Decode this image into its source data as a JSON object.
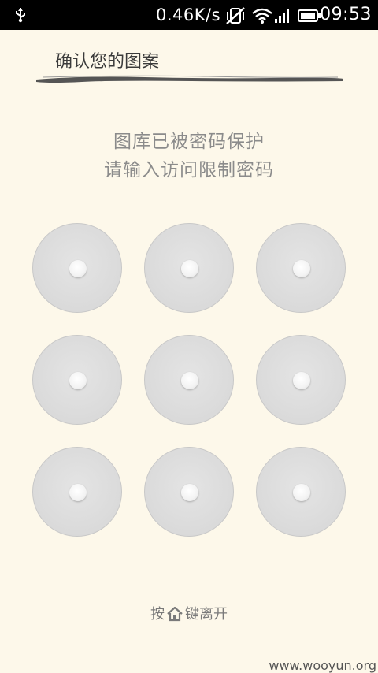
{
  "status_bar": {
    "net_speed": "0.46K/s",
    "clock": "09:53",
    "icons": [
      "usb-icon",
      "vibrate-silent-icon",
      "wifi-icon",
      "signal-icon",
      "battery-icon"
    ]
  },
  "screen": {
    "title": "确认您的图案",
    "prompt_line1": "图库已被密码保护",
    "prompt_line2": "请输入访问限制密码",
    "pattern_dots": [
      {
        "id": 1
      },
      {
        "id": 2
      },
      {
        "id": 3
      },
      {
        "id": 4
      },
      {
        "id": 5
      },
      {
        "id": 6
      },
      {
        "id": 7
      },
      {
        "id": 8
      },
      {
        "id": 9
      }
    ],
    "footer_prefix": "按",
    "footer_suffix": "键离开"
  },
  "watermark": "www.wooyun.org"
}
